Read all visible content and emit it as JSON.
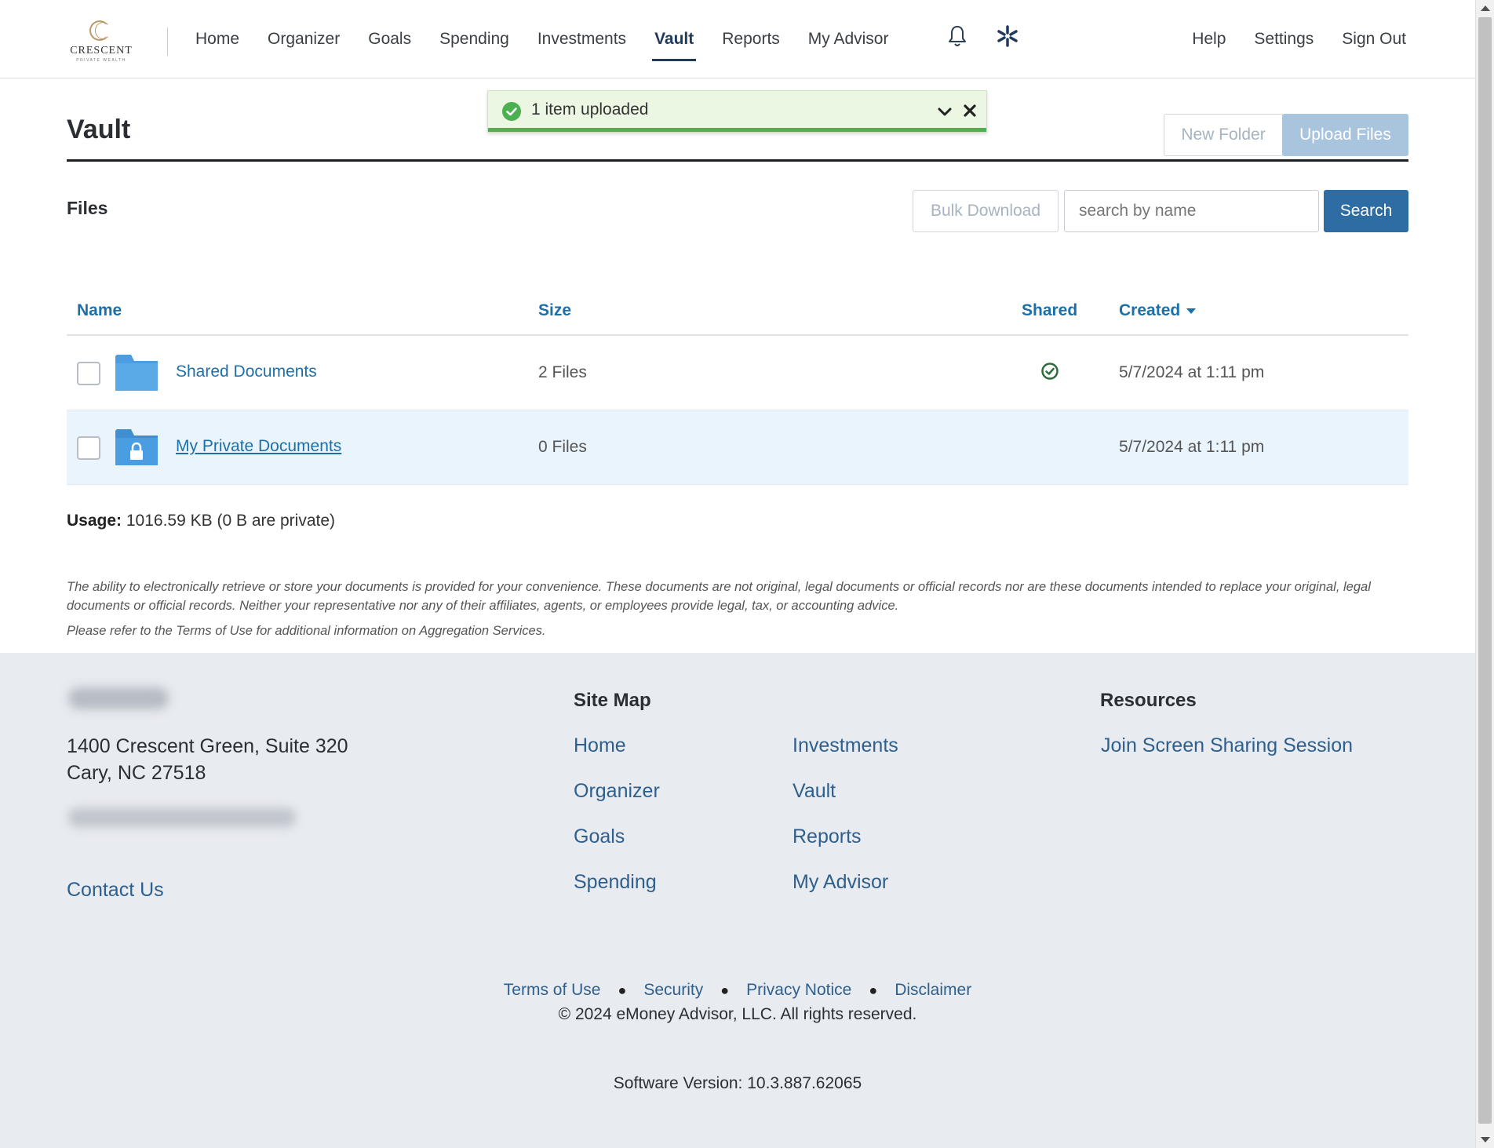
{
  "brand": {
    "logo_text": "CRESCENT",
    "logo_sub": "PRIVATE WEALTH"
  },
  "nav": {
    "items": [
      {
        "label": "Home"
      },
      {
        "label": "Organizer"
      },
      {
        "label": "Goals"
      },
      {
        "label": "Spending"
      },
      {
        "label": "Investments"
      },
      {
        "label": "Vault",
        "active": true
      },
      {
        "label": "Reports"
      },
      {
        "label": "My Advisor"
      }
    ],
    "icons": [
      "bell-icon",
      "asterisk-spark-icon"
    ],
    "right": {
      "help": "Help",
      "settings": "Settings",
      "sign_out": "Sign Out"
    }
  },
  "toast": {
    "message": "1 item uploaded",
    "status_color": "#4caf50",
    "icons": [
      "check-circle-icon",
      "chevron-down-icon",
      "close-icon"
    ]
  },
  "page": {
    "title": "Vault",
    "new_folder_label": "New Folder",
    "upload_label": "Upload Files"
  },
  "files": {
    "label": "Files",
    "bulk_download_label": "Bulk Download",
    "search_placeholder": "search by name",
    "search_label": "Search",
    "columns": {
      "name": "Name",
      "size": "Size",
      "shared": "Shared",
      "created": "Created"
    },
    "rows": [
      {
        "name": "Shared Documents",
        "size": "2 Files",
        "shared": true,
        "created": "5/7/2024 at 1:11 pm",
        "icon": "folder-icon"
      },
      {
        "name": "My Private Documents",
        "size": "0 Files",
        "shared": false,
        "created": "5/7/2024 at 1:11 pm",
        "icon": "locked-folder-icon"
      }
    ]
  },
  "usage": {
    "label": "Usage:",
    "value": "1016.59 KB (0 B are private)"
  },
  "disclaimer": {
    "text": "The ability to electronically retrieve or store your documents is provided for your convenience. These documents are not original, legal documents or official records nor are these documents intended to replace your original, legal documents or official records. Neither your representative nor any of their affiliates, agents, or employees provide legal, tax, or accounting advice.",
    "terms_note": "Please refer to the Terms of Use for additional information on Aggregation Services."
  },
  "footer": {
    "address_line1": "1400 Crescent Green, Suite 320",
    "address_line2": "Cary, NC 27518",
    "contact_label": "Contact Us",
    "sitemap_heading": "Site Map",
    "sitemap_col_a": [
      "Home",
      "Organizer",
      "Goals",
      "Spending"
    ],
    "sitemap_col_b": [
      "Investments",
      "Vault",
      "Reports",
      "My Advisor"
    ],
    "resources_heading": "Resources",
    "resources_link": "Join Screen Sharing Session",
    "legal": [
      "Terms of Use",
      "Security",
      "Privacy Notice",
      "Disclaimer"
    ],
    "copyright": "© 2024 eMoney Advisor, LLC. All rights reserved.",
    "version": "Software Version: 10.3.887.62065"
  },
  "colors": {
    "link": "#1d6fa8",
    "primary_button": "#2e6da4",
    "upload_button_disabled": "#a9c5dd",
    "footer_bg": "#e8ebf0",
    "row_highlight": "#eaf4fc",
    "folder": "#4a9de0"
  }
}
